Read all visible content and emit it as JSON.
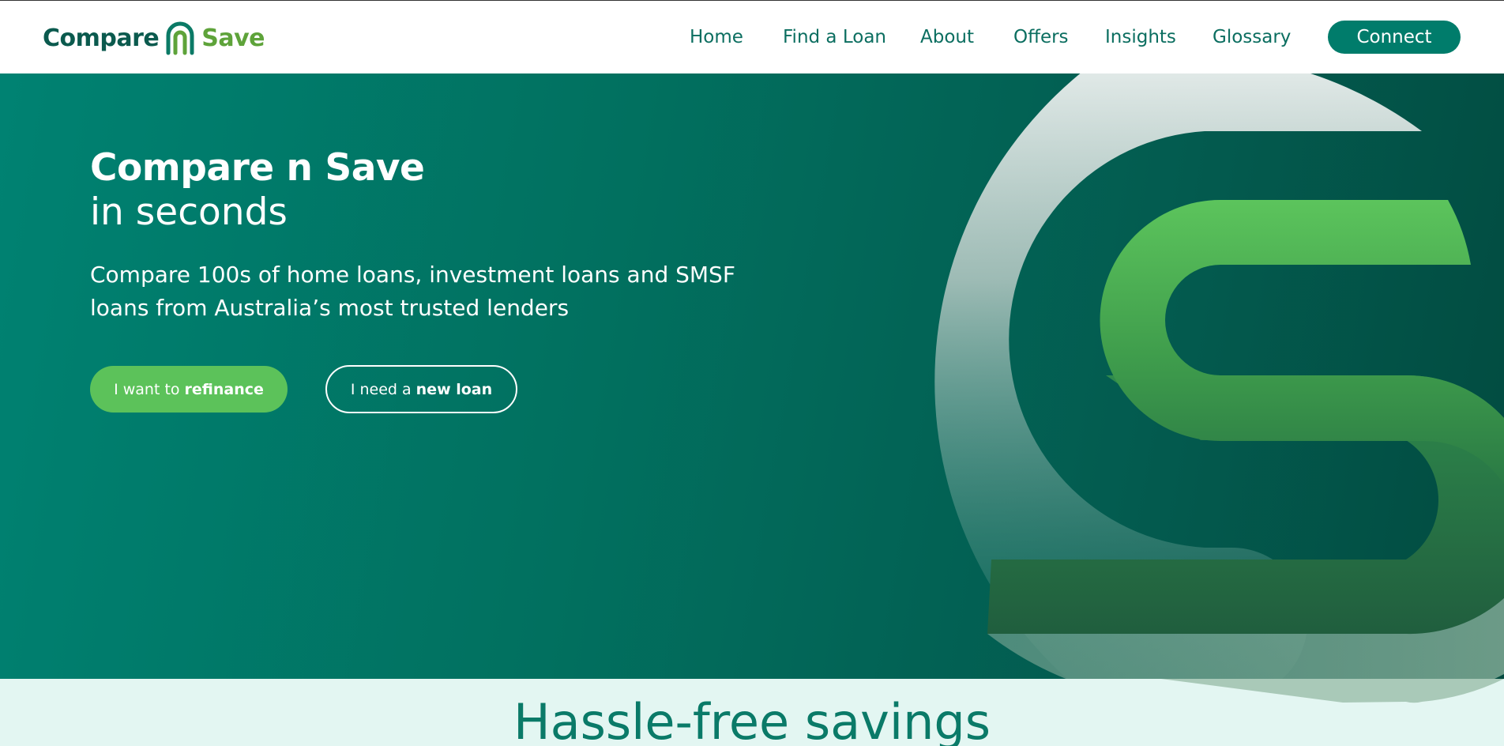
{
  "brand": {
    "compare": "Compare",
    "save": "Save",
    "logo_icon": "arch-n-icon"
  },
  "nav": {
    "items": [
      {
        "label": "Home"
      },
      {
        "label": "Find a Loan"
      },
      {
        "label": "About"
      },
      {
        "label": "Offers"
      },
      {
        "label": "Insights"
      },
      {
        "label": "Glossary"
      }
    ],
    "connect_label": "Connect"
  },
  "hero": {
    "title_line1": "Compare n Save",
    "title_line2": "in seconds",
    "subtitle": "Compare 100s of home loans, investment loans and SMSF loans from Australia’s most trusted lenders",
    "refinance_prefix": "I want to",
    "refinance_bold": "refinance",
    "newloan_prefix": "I need a",
    "newloan_bold": "new loan"
  },
  "section": {
    "title": "Hassle-free savings"
  },
  "colors": {
    "brand_dark": "#0b5a4e",
    "brand_green": "#5ea33a",
    "accent_teal": "#007c6b",
    "button_green": "#5cc25a",
    "section_bg": "#e3f6f2"
  }
}
